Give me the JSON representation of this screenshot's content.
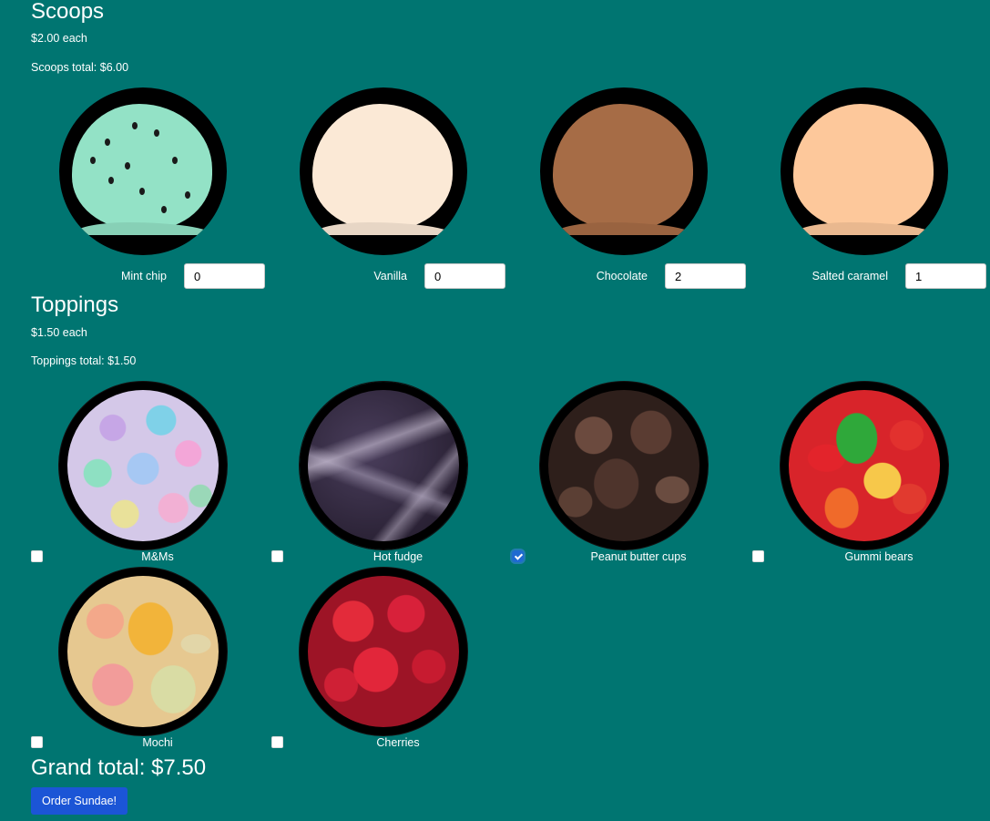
{
  "scoops": {
    "title": "Scoops",
    "price": "$2.00 each",
    "total": "Scoops total: $6.00",
    "items": [
      {
        "name": "Mint chip",
        "value": "0",
        "color": "#93e2c6"
      },
      {
        "name": "Vanilla",
        "value": "0",
        "color": "#fbe9d6"
      },
      {
        "name": "Chocolate",
        "value": "2",
        "color": "#a66c46"
      },
      {
        "name": "Salted caramel",
        "value": "1",
        "color": "#fdc89b"
      }
    ]
  },
  "toppings": {
    "title": "Toppings",
    "price": "$1.50 each",
    "total": "Toppings total: $1.50",
    "items": [
      {
        "name": "M&Ms",
        "checked": false
      },
      {
        "name": "Hot fudge",
        "checked": false
      },
      {
        "name": "Peanut butter cups",
        "checked": true
      },
      {
        "name": "Gummi bears",
        "checked": false
      },
      {
        "name": "Mochi",
        "checked": false
      },
      {
        "name": "Cherries",
        "checked": false
      }
    ]
  },
  "grand_total": "Grand total: $7.50",
  "order_button": "Order Sundae!",
  "colors": {
    "background": "#007571",
    "button": "#1b55d6"
  }
}
